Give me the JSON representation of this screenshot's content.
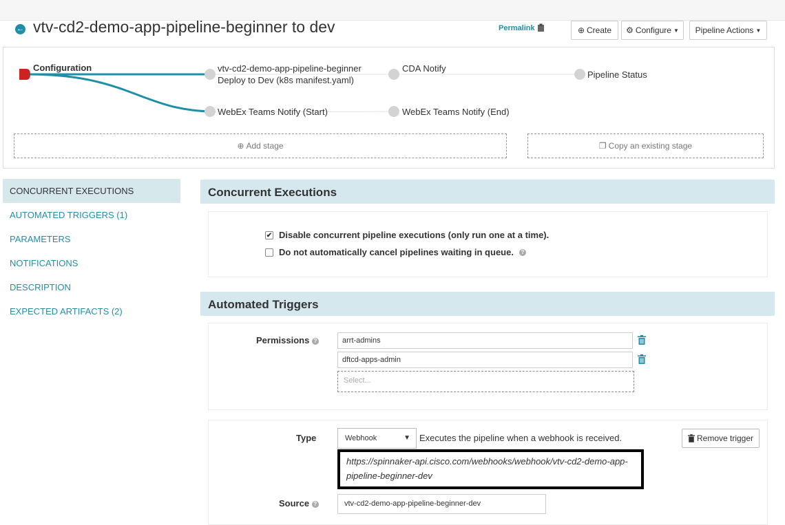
{
  "header": {
    "title": "vtv-cd2-demo-app-pipeline-beginner to dev",
    "permalink": "Permalink",
    "create_label": "Create",
    "configure_label": "Configure",
    "actions_label": "Pipeline Actions"
  },
  "graph": {
    "stages": {
      "configuration": "Configuration",
      "deploy_line1": "vtv-cd2-demo-app-pipeline-beginner",
      "deploy_line2": "Deploy to Dev (k8s manifest.yaml)",
      "webex_start": "WebEx Teams Notify (Start)",
      "cda_notify": "CDA Notify",
      "webex_end": "WebEx Teams Notify (End)",
      "pipeline_status": "Pipeline Status"
    },
    "add_stage": "Add stage",
    "copy_stage": "Copy an existing stage"
  },
  "sidebar": {
    "items": [
      {
        "label": "CONCURRENT EXECUTIONS"
      },
      {
        "label": "AUTOMATED TRIGGERS (1)"
      },
      {
        "label": "PARAMETERS"
      },
      {
        "label": "NOTIFICATIONS"
      },
      {
        "label": "DESCRIPTION"
      },
      {
        "label": "EXPECTED ARTIFACTS (2)"
      }
    ]
  },
  "concurrent": {
    "heading": "Concurrent Executions",
    "disable_label": "Disable concurrent pipeline executions (only run one at a time).",
    "disable_checked": true,
    "no_cancel_label": "Do not automatically cancel pipelines waiting in queue.",
    "no_cancel_checked": false
  },
  "triggers": {
    "heading": "Automated Triggers",
    "permissions_label": "Permissions",
    "permissions": [
      "arrt-admins",
      "dftcd-apps-admin"
    ],
    "select_placeholder": "Select...",
    "type_label": "Type",
    "type_value": "Webhook",
    "type_description": "Executes the pipeline when a webhook is received.",
    "remove_label": "Remove trigger",
    "webhook_url_line1": "https://spinnaker-api.cisco.com/webhooks/webhook/vtv-cd2-demo-app-",
    "webhook_url_line2": "pipeline-beginner-dev",
    "source_label": "Source",
    "source_value": "vtv-cd2-demo-app-pipeline-beginner-dev"
  },
  "colors": {
    "accent": "#1f8fa8",
    "section_bg": "#d5e8ee",
    "config_node": "#cc2222",
    "node_gray": "#d3d3d3"
  }
}
